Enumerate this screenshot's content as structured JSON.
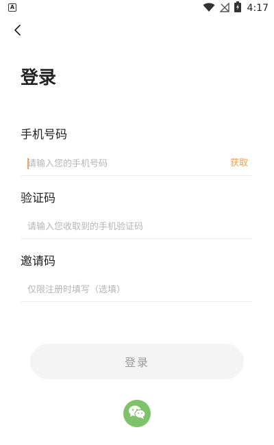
{
  "status_bar": {
    "time": "4:17",
    "notification_glyph": "A",
    "icons": [
      "wifi-icon",
      "no-signal-icon",
      "battery-charging-icon"
    ]
  },
  "header": {
    "back_icon": "chevron-left-icon"
  },
  "title": "登录",
  "fields": {
    "phone": {
      "label": "手机号码",
      "value": "",
      "placeholder": "请输入您的手机号码",
      "action_label": "获取"
    },
    "code": {
      "label": "验证码",
      "value": "",
      "placeholder": "请输入您收取到的手机验证码"
    },
    "invite": {
      "label": "邀请码",
      "value": "",
      "placeholder": "仅限注册时填写（选填）"
    }
  },
  "login_button": {
    "label": "登录"
  },
  "wechat": {
    "icon": "wechat-icon"
  },
  "colors": {
    "accent": "#e8a050",
    "wechat_green": "#7ec26a",
    "button_bg": "#f4f4f4",
    "placeholder": "#b6b6b6"
  }
}
